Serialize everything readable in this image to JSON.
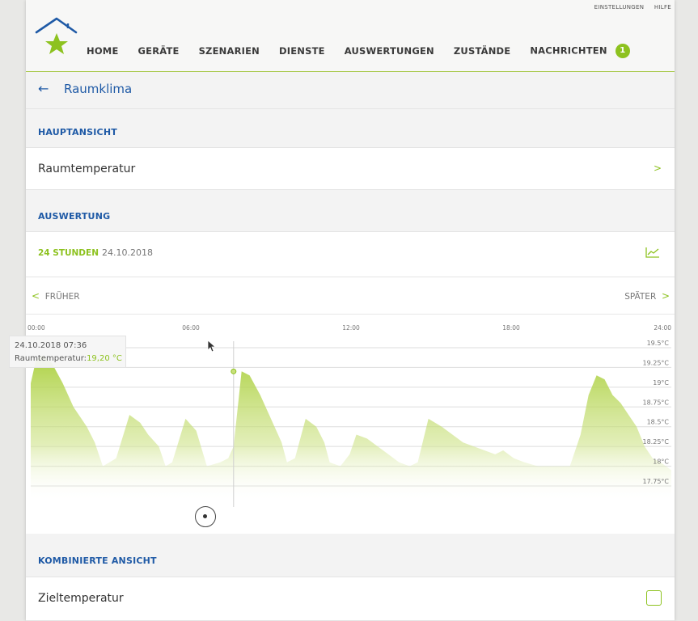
{
  "header": {
    "top_links": [
      "EINSTELLUNGEN",
      "HILFE"
    ],
    "nav": [
      {
        "label": "HOME"
      },
      {
        "label": "GERÄTE"
      },
      {
        "label": "SZENARIEN"
      },
      {
        "label": "DIENSTE"
      },
      {
        "label": "AUSWERTUNGEN"
      },
      {
        "label": "ZUSTÄNDE"
      },
      {
        "label": "NACHRICHTEN",
        "badge": "1"
      }
    ]
  },
  "page": {
    "back_icon": "arrow-left-icon",
    "title": "Raumklima"
  },
  "sections": {
    "main_view": {
      "heading": "HAUPTANSICHT",
      "item": "Raumtemperatur"
    },
    "evaluation": {
      "heading": "AUSWERTUNG",
      "range_label": "24 STUNDEN",
      "range_date": "24.10.2018"
    },
    "combined": {
      "heading": "KOMBINIERTE ANSICHT",
      "item": "Zieltemperatur"
    }
  },
  "pager": {
    "earlier": "FRÜHER",
    "later": "SPÄTER"
  },
  "tooltip": {
    "date": "24.10.2018 07:36",
    "label": "Raumtemperatur:",
    "value": "19,20 °C"
  },
  "colors": {
    "accent": "#8dc21f",
    "brand_blue": "#1f5aa6"
  },
  "chart_data": {
    "type": "area",
    "x_ticks": [
      "00:00",
      "06:00",
      "12:00",
      "18:00",
      "24:00"
    ],
    "y_ticks": [
      "17.75°C",
      "18°C",
      "18.25°C",
      "18.5°C",
      "18.75°C",
      "19°C",
      "19.25°C",
      "19.5°C"
    ],
    "ylim": [
      17.75,
      19.5
    ],
    "xlim": [
      0,
      24
    ],
    "x_unit": "hours",
    "series": [
      {
        "x": [
          0,
          0.2,
          0.45,
          0.8,
          1.2,
          1.6,
          1.9,
          2.1,
          2.4,
          2.7,
          2.95,
          3.2,
          3.7,
          4.1,
          4.4,
          4.8,
          5.05,
          5.3,
          5.8,
          6.2,
          6.6,
          7.1,
          7.4,
          7.6,
          7.9,
          8.2,
          8.6,
          9.0,
          9.4,
          9.6,
          9.9,
          10.3,
          10.7,
          11.0,
          11.2,
          11.6,
          11.95,
          12.2,
          12.6,
          13.0,
          13.4,
          13.8,
          14.2,
          14.5,
          14.9,
          15.4,
          15.8,
          16.2,
          16.6,
          17.0,
          17.4,
          17.7,
          18.1,
          18.5,
          19.0,
          19.5,
          20.2,
          20.6,
          20.9,
          21.2,
          21.5,
          21.8,
          22.1,
          22.4,
          22.7,
          23.0,
          23.3,
          23.6,
          24.0
        ],
        "y": [
          19.05,
          19.35,
          19.4,
          19.3,
          19.05,
          18.75,
          18.6,
          18.5,
          18.3,
          18.0,
          18.05,
          18.1,
          18.65,
          18.55,
          18.4,
          18.25,
          18.0,
          18.05,
          18.6,
          18.45,
          18.0,
          18.05,
          18.1,
          18.25,
          19.2,
          19.15,
          18.9,
          18.6,
          18.3,
          18.05,
          18.1,
          18.6,
          18.5,
          18.3,
          18.05,
          18.0,
          18.15,
          18.4,
          18.35,
          18.25,
          18.15,
          18.05,
          18.0,
          18.05,
          18.6,
          18.5,
          18.4,
          18.3,
          18.25,
          18.2,
          18.15,
          18.2,
          18.1,
          18.05,
          18.0,
          18.0,
          18.0,
          18.4,
          18.9,
          19.15,
          19.1,
          18.9,
          18.8,
          18.65,
          18.5,
          18.25,
          18.1,
          18.05,
          17.95
        ],
        "color": "#a9cf3a"
      }
    ],
    "grid": true,
    "highlight": {
      "x": 7.6,
      "y": 19.2
    }
  }
}
